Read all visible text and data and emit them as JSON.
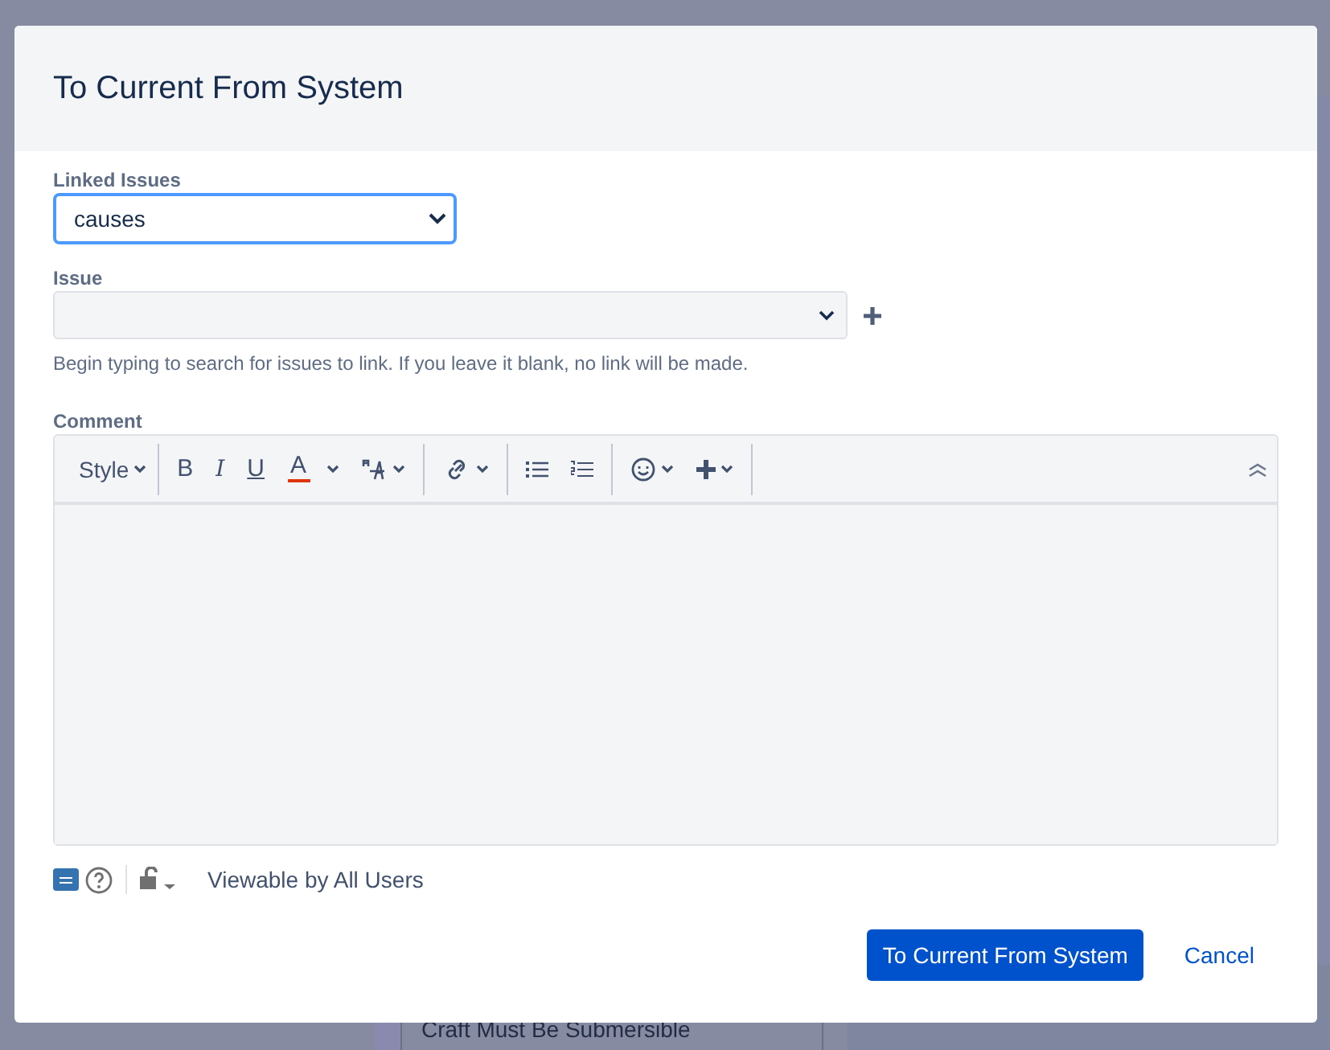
{
  "background": {
    "card_text": "Craft Must Be Submersible"
  },
  "dialog": {
    "title": "To Current From System",
    "linked_issues": {
      "label": "Linked Issues",
      "value": "causes",
      "focused": true
    },
    "issue": {
      "label": "Issue",
      "hint": "Begin typing to search for issues to link. If you leave it blank, no link will be made."
    },
    "comment": {
      "label": "Comment",
      "toolbar": [
        [
          {
            "kind": "style",
            "label": "Style"
          }
        ],
        [
          {
            "kind": "bold",
            "label": "B"
          },
          {
            "kind": "italic",
            "label": "I"
          },
          {
            "kind": "underline",
            "label": "U"
          },
          {
            "kind": "text-color",
            "label": "A"
          },
          {
            "kind": "text-size"
          }
        ],
        [
          {
            "kind": "link"
          }
        ],
        [
          {
            "kind": "bullet-list"
          },
          {
            "kind": "numbered-list"
          }
        ],
        [
          {
            "kind": "emoji"
          },
          {
            "kind": "insert"
          }
        ]
      ],
      "visibility": "Viewable by All Users"
    },
    "buttons": [
      {
        "kind": "primary",
        "label": "To Current From System"
      },
      {
        "kind": "link",
        "label": "Cancel"
      }
    ]
  }
}
